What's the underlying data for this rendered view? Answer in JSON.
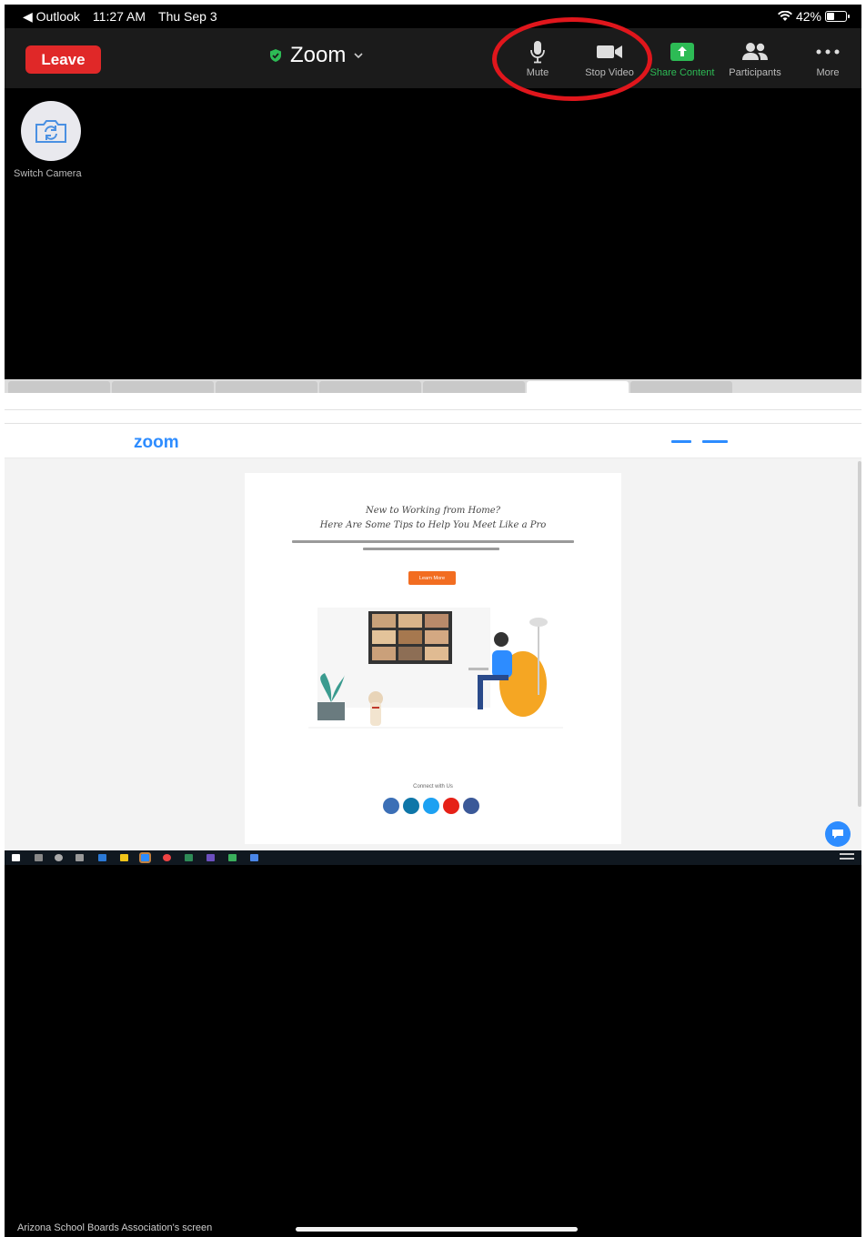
{
  "status_bar": {
    "back_app": "◀ Outlook",
    "time": "11:27 AM",
    "date": "Thu Sep 3",
    "battery": "42%",
    "battery_level": 0.42
  },
  "toolbar": {
    "leave_label": "Leave",
    "meeting_title": "Zoom",
    "items": [
      {
        "label": "Mute",
        "icon": "microphone-icon"
      },
      {
        "label": "Stop Video",
        "icon": "video-camera-icon"
      },
      {
        "label": "Share Content",
        "icon": "share-screen-icon"
      },
      {
        "label": "Participants",
        "icon": "participants-icon"
      },
      {
        "label": "More",
        "icon": "more-icon"
      }
    ]
  },
  "switch_camera_label": "Switch Camera",
  "shared_screen": {
    "page_heading_1": "New to Working from Home?",
    "page_heading_2": "Here Are Some Tips to Help You Meet Like a Pro",
    "button_label": "Learn More",
    "connect_label": "Connect with Us",
    "logo_text": "zoom"
  },
  "screen_owner": "Arizona School Boards Association's screen",
  "colors": {
    "leave": "#e02828",
    "share_green": "#2dbb55",
    "highlight": "#e0161c",
    "zoom_blue": "#2d8cff"
  }
}
